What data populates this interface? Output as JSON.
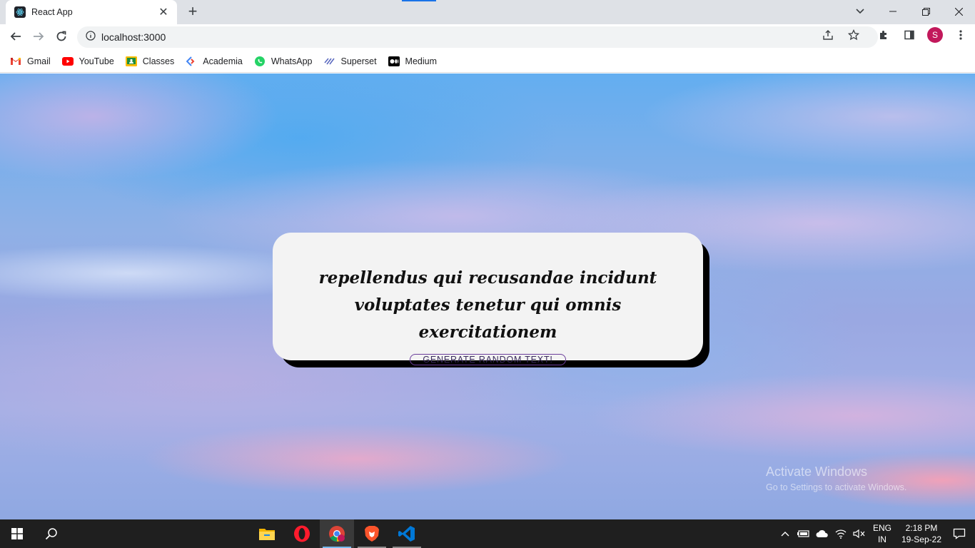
{
  "browser": {
    "tab_title": "React App",
    "url": "localhost:3000",
    "profile_initial": "S"
  },
  "bookmarks": [
    {
      "label": "Gmail",
      "icon": "gmail-icon"
    },
    {
      "label": "YouTube",
      "icon": "youtube-icon"
    },
    {
      "label": "Classes",
      "icon": "classroom-icon"
    },
    {
      "label": "Academia",
      "icon": "academia-icon"
    },
    {
      "label": "WhatsApp",
      "icon": "whatsapp-icon"
    },
    {
      "label": "Superset",
      "icon": "superset-icon"
    },
    {
      "label": "Medium",
      "icon": "medium-icon"
    }
  ],
  "app": {
    "quote": "repellendus qui recusandae incidunt voluptates tenetur qui omnis exercitationem",
    "button_label": "GENERATE RANDOM TEXT!"
  },
  "watermark": {
    "title": "Activate Windows",
    "subtitle": "Go to Settings to activate Windows."
  },
  "taskbar": {
    "language_primary": "ENG",
    "language_secondary": "IN",
    "time": "2:18 PM",
    "date": "19-Sep-22"
  },
  "colors": {
    "button_border": "#6a3d9a",
    "card_bg": "#f3f3f3",
    "avatar": "#c2185b"
  }
}
